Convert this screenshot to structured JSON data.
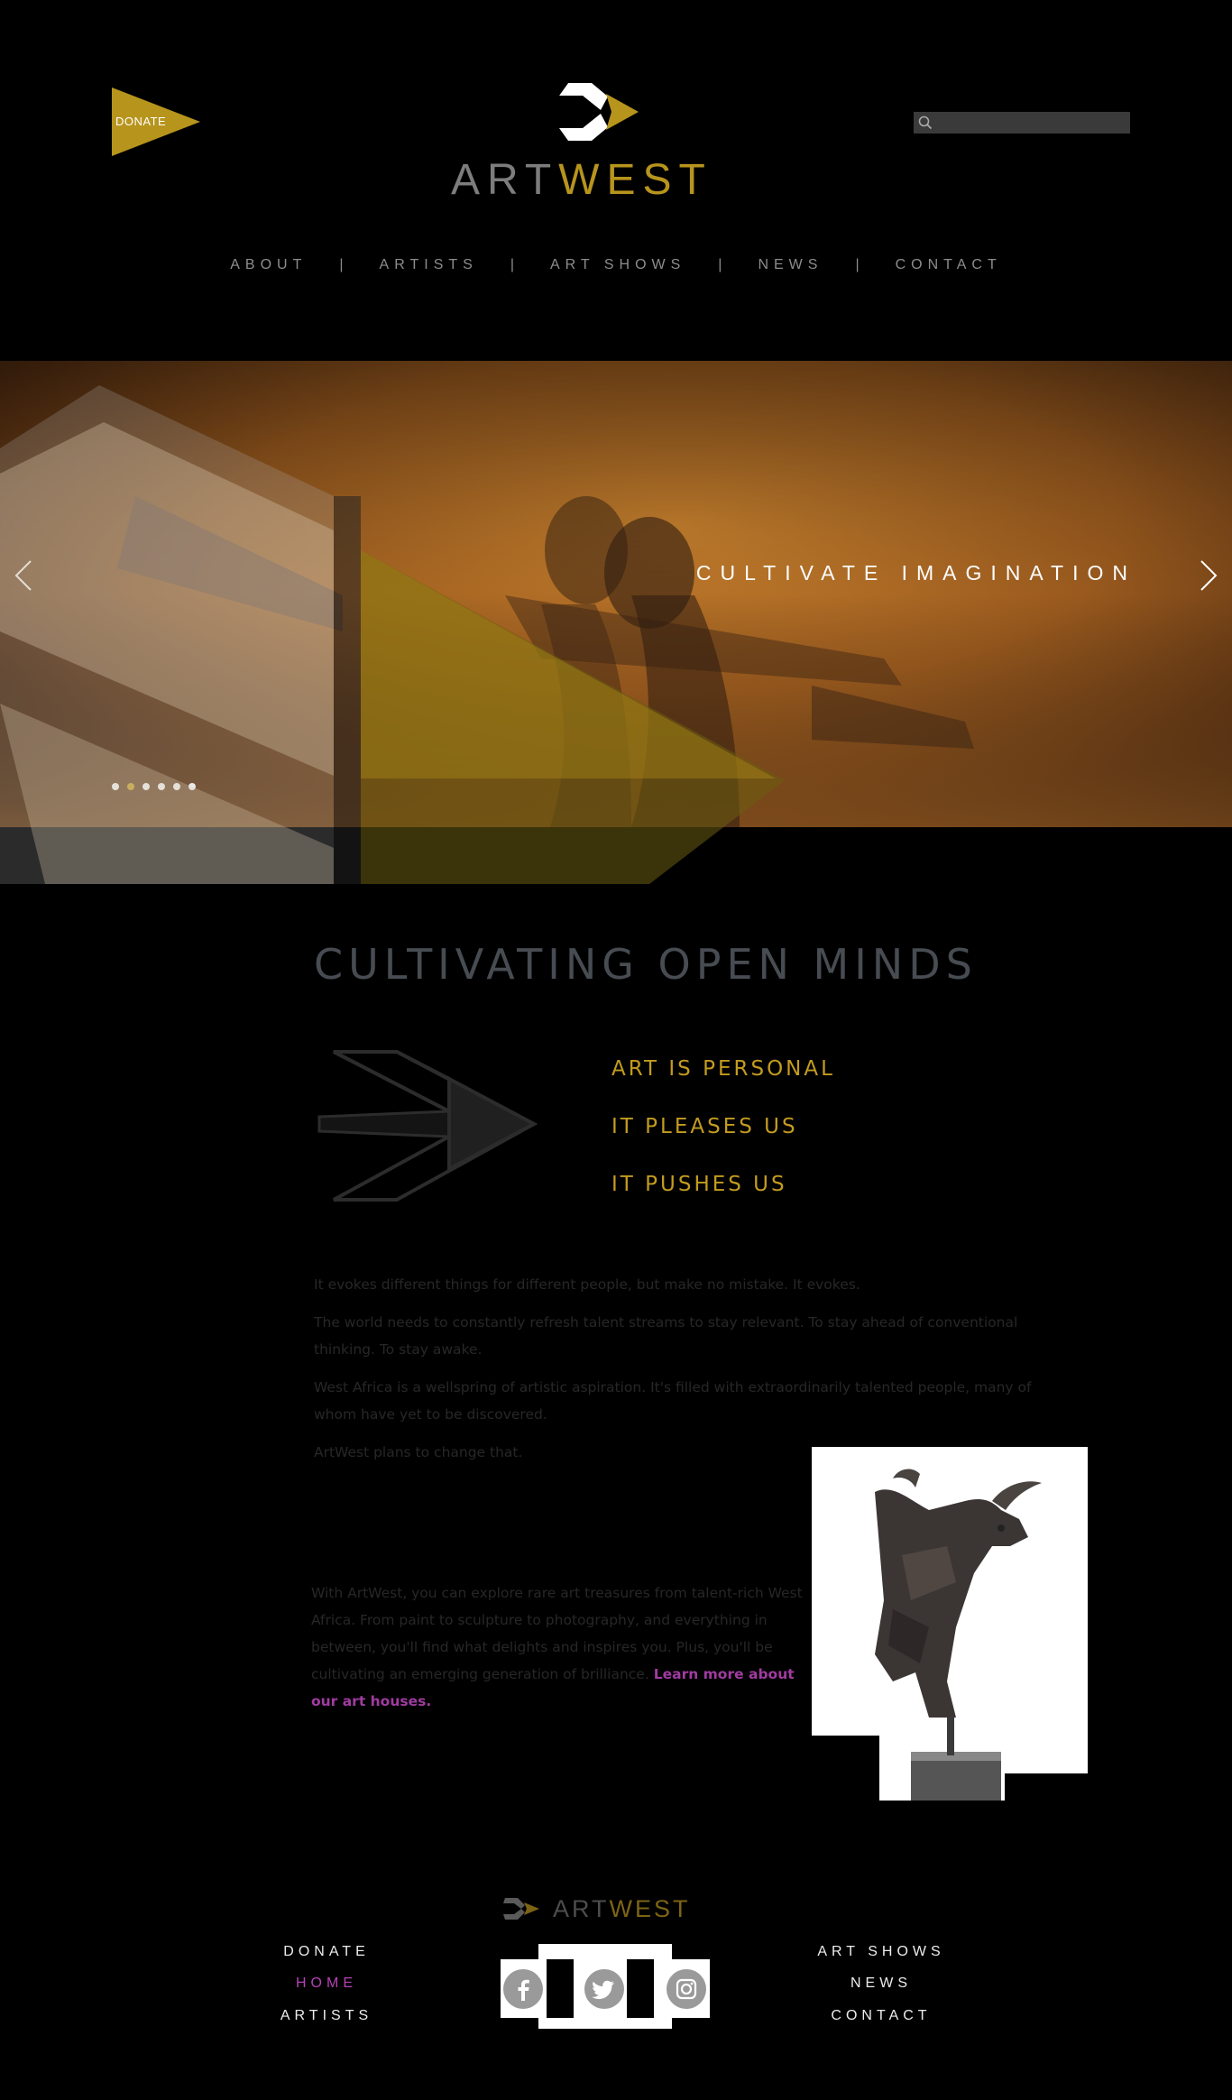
{
  "header": {
    "donate_label": "DONATE",
    "logo": {
      "art": "ART",
      "west": "WEST"
    },
    "search": {
      "placeholder": "",
      "value": ""
    }
  },
  "nav": {
    "items": [
      "ABOUT",
      "ARTISTS",
      "ART SHOWS",
      "NEWS",
      "CONTACT"
    ],
    "separator": "|"
  },
  "hero": {
    "title": "CULTIVATE IMAGINATION",
    "slide_count": 6,
    "active_slide": 2
  },
  "main": {
    "title": "CULTIVATING OPEN MINDS",
    "taglines": [
      "ART IS PERSONAL",
      "IT PLEASES US",
      "IT PUSHES US"
    ],
    "paragraphs": [
      "It evokes different things for different people, but make no mistake. It evokes.",
      "The world needs to constantly refresh talent streams to stay relevant. To stay ahead of conventional thinking. To stay awake.",
      "West Africa is a wellspring of artistic aspiration. It's filled with extraordinarily talented people, many of whom have yet to be discovered.",
      "ArtWest plans to change that."
    ],
    "closing": "With ArtWest, you can explore rare art treasures from talent-rich West Africa. From paint to sculpture to photography, and everything in between, you'll find what delights and inspires you. Plus, you'll be cultivating an emerging generation of brilliance.",
    "closing_link": "Learn more about our art houses."
  },
  "footer": {
    "logo": {
      "art": "ART",
      "west": "WEST"
    },
    "left_links": [
      "DONATE",
      "HOME",
      "ARTISTS"
    ],
    "right_links": [
      "ART SHOWS",
      "NEWS",
      "CONTACT"
    ],
    "active_link": "HOME",
    "social_icons": [
      "facebook-icon",
      "twitter-icon",
      "instagram-icon"
    ]
  },
  "colors": {
    "gold": "#b7941c",
    "gray_text": "#474c52",
    "link_purple": "#a13ba1"
  }
}
